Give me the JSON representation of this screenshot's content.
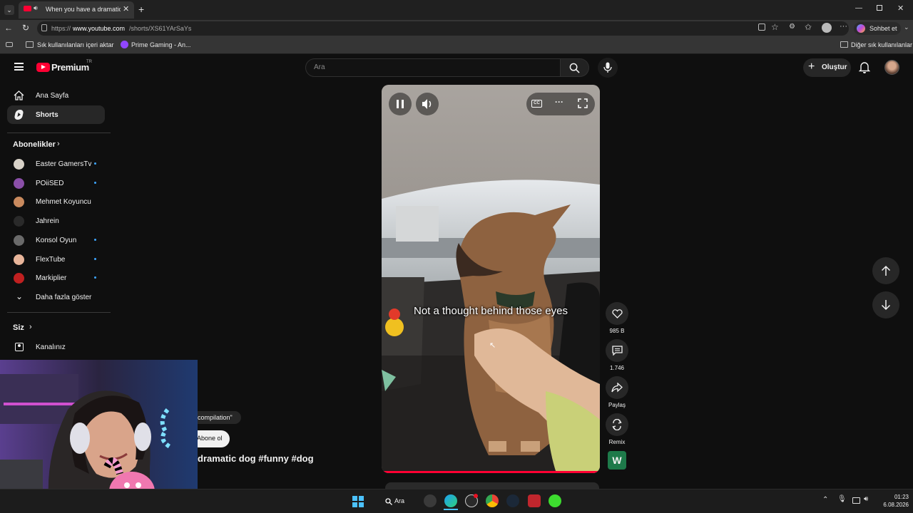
{
  "browser": {
    "tab_title": "When you have a dramatic do",
    "url_prefix": "https://",
    "url_host": "www.youtube.com",
    "url_path": "/shorts/XS61YArSaYs",
    "copilot_label": "Sohbet et",
    "bookmarks": [
      {
        "label": "Sık kullanılanları içeri aktar"
      },
      {
        "label": "Prime Gaming - An..."
      }
    ],
    "other_favorites": "Diğer sık kullanılanlar"
  },
  "youtube": {
    "logo_text": "Premium",
    "logo_region": "TR",
    "search_placeholder": "Ara",
    "create_label": "Oluştur",
    "sidebar": {
      "home": "Ana Sayfa",
      "shorts": "Shorts",
      "subscriptions_header": "Abonelikler",
      "subscriptions": [
        {
          "name": "Easter GamersTv",
          "color": "#d8d2c8",
          "new": true
        },
        {
          "name": "POiiSED",
          "color": "#8a4fa8",
          "new": true
        },
        {
          "name": "Mehmet Koyuncu",
          "color": "#c98a5e",
          "new": false
        },
        {
          "name": "Jahrein",
          "color": "#2a2a2a",
          "new": false
        },
        {
          "name": "Konsol Oyun",
          "color": "#6a6a6a",
          "new": true
        },
        {
          "name": "FlexTube",
          "color": "#e8b59a",
          "new": true
        },
        {
          "name": "Markiplier",
          "color": "#c02020",
          "new": true
        }
      ],
      "show_more": "Daha fazla göster",
      "you_header": "Siz",
      "your_channel": "Kanalınız"
    },
    "short": {
      "caption": "Not a thought behind those eyes",
      "likes": "985 B",
      "comments": "1.746",
      "share_label": "Paylaş",
      "remix_label": "Remix",
      "channel_initial": "W",
      "tag_chip": "compilation\"",
      "subscribe_label": "Abone ol",
      "title_fragment": "dramatic dog #funny #dog",
      "progress_fraction": 0.99
    }
  },
  "taskbar": {
    "search_label": "Ara",
    "time": "01:23",
    "date": "6.08.2026"
  },
  "colors": {
    "yt_red": "#ff0033",
    "subscribe_bg": "#f1f1f1",
    "remix_channel_bg": "#1e7a4a"
  }
}
